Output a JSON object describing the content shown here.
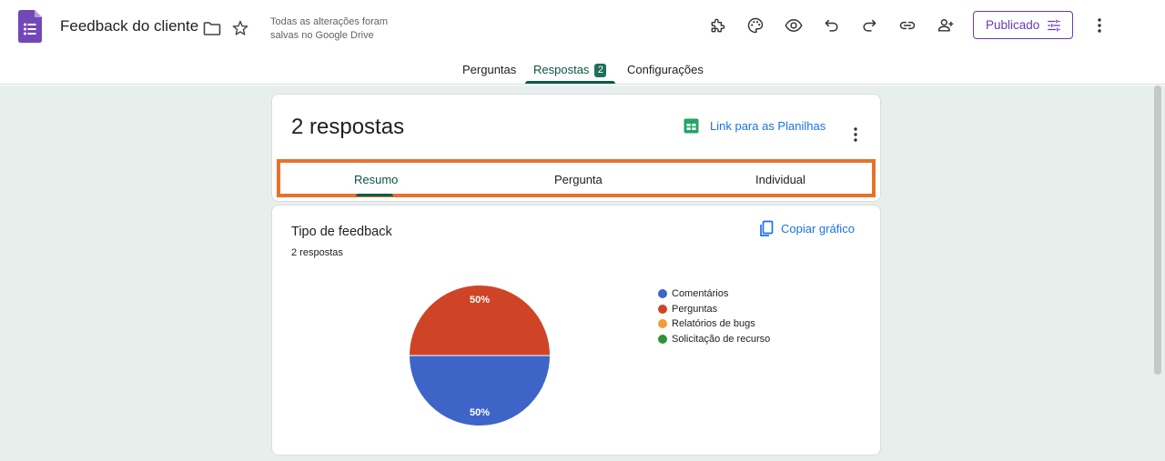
{
  "header": {
    "title": "Feedback do cliente",
    "save_status_line1": "Todas as alterações foram",
    "save_status_line2": "salvas no Google Drive",
    "publish_label": "Publicado",
    "accent_color": "#673ab7",
    "icons": [
      "addon-icon",
      "palette-icon",
      "preview-eye-icon",
      "undo-icon",
      "redo-icon",
      "link-icon",
      "add-collaborator-icon",
      "more-vert-icon"
    ]
  },
  "tabs": {
    "questions": "Perguntas",
    "responses": "Respostas",
    "responses_count": "2",
    "settings": "Configurações"
  },
  "summary": {
    "title": "2 respostas",
    "sheets_link": "Link para as Planilhas",
    "subtabs": {
      "summary": "Resumo",
      "question": "Pergunta",
      "individual": "Individual"
    }
  },
  "chart_card": {
    "title": "Tipo de feedback",
    "response_count": "2 respostas",
    "copy_label": "Copiar gráfico"
  },
  "chart_data": {
    "type": "pie",
    "categories": [
      "Comentários",
      "Perguntas",
      "Relatórios de bugs",
      "Solicitação de recurso"
    ],
    "values": [
      50,
      50,
      0,
      0
    ],
    "data_labels": [
      "50%",
      "50%",
      "",
      ""
    ],
    "colors": [
      "#3e64c8",
      "#cf4427",
      "#f39c34",
      "#2f9438"
    ],
    "legend_position": "right"
  }
}
